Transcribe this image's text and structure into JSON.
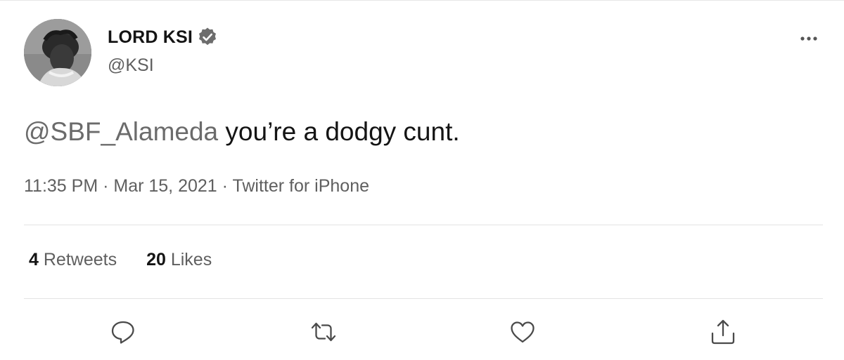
{
  "user": {
    "display_name": "LORD KSI",
    "handle": "@KSI",
    "verified": true
  },
  "tweet": {
    "mention": "@SBF_Alameda",
    "text": " you’re a dodgy cunt.",
    "time": "11:35 PM",
    "date": "Mar 15, 2021",
    "source": "Twitter for iPhone",
    "separator": " · "
  },
  "stats": {
    "retweets_count": "4",
    "retweets_label": "Retweets",
    "likes_count": "20",
    "likes_label": "Likes"
  },
  "actions": {
    "icons": [
      "reply-icon",
      "retweet-icon",
      "like-icon",
      "share-icon"
    ]
  },
  "colors": {
    "text_primary": "#141414",
    "text_secondary": "#5f5f5f",
    "divider": "#e3e3e3"
  }
}
